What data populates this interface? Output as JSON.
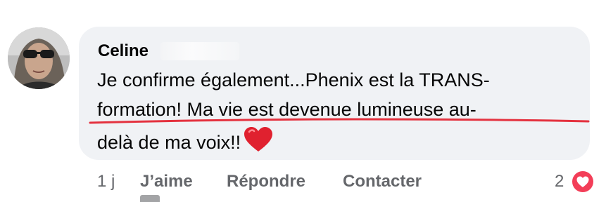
{
  "comment": {
    "author": "Celine",
    "lines": [
      "Je confirme également...Phenix est la TRANS-",
      "formation! Ma vie est devenue lumineuse au-",
      "delà de ma voix!!"
    ],
    "emoji": "red-heart-emoji"
  },
  "footer": {
    "time": "1 j",
    "like_label": "J’aime",
    "reply_label": "Répondre",
    "contact_label": "Contacter",
    "reaction_count": "2",
    "reaction_icon": "heart-reaction-icon"
  },
  "colors": {
    "bubble": "#f0f2f5",
    "text": "#050505",
    "secondary": "#65676b",
    "underline": "#e4323f",
    "heart": "#f33e58"
  }
}
